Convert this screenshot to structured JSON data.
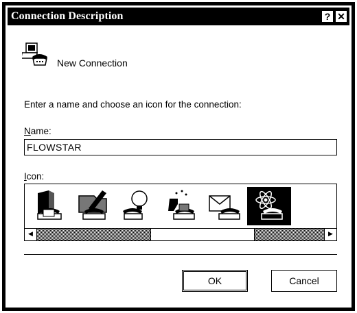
{
  "window": {
    "title": "Connection Description",
    "help_glyph": "?",
    "close_glyph": "✕"
  },
  "header": {
    "icon": "dial-up-connection-icon",
    "text": "New Connection"
  },
  "instruction": "Enter a name and choose an icon for the connection:",
  "name_field": {
    "label": "Name:",
    "value": "FLOWSTAR"
  },
  "icon_field": {
    "label": "Icon:",
    "icons": [
      "book-phone-icon",
      "folder-pen-phone-icon",
      "lightbulb-phone-icon",
      "chemistry-phone-icon",
      "envelope-phone-icon",
      "atom-phone-icon"
    ],
    "selected_index": 5,
    "scroll_position": 0.62
  },
  "buttons": {
    "ok": "OK",
    "cancel": "Cancel"
  },
  "scroll": {
    "left_glyph": "◀",
    "right_glyph": "▶"
  }
}
